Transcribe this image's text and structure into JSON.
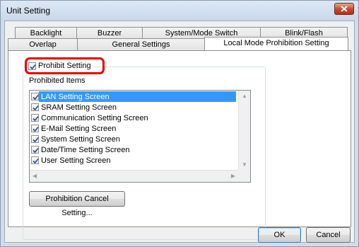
{
  "window": {
    "title": "Unit Setting"
  },
  "tabs": {
    "row_back": [
      "Backlight",
      "Buzzer",
      "System/Mode Switch",
      "Blink/Flash"
    ],
    "row_front": [
      "Overlap",
      "General Settings",
      "Local Mode Prohibition Setting"
    ],
    "active": "Local Mode Prohibition Setting"
  },
  "prohibit": {
    "label": "Prohibit Setting",
    "checked": true
  },
  "items": {
    "label": "Prohibited Items",
    "list": [
      {
        "label": "LAN Setting Screen",
        "checked": true,
        "selected": true
      },
      {
        "label": "SRAM Setting Screen",
        "checked": true,
        "selected": false
      },
      {
        "label": "Communication Setting Screen",
        "checked": true,
        "selected": false
      },
      {
        "label": "E-Mail Setting Screen",
        "checked": true,
        "selected": false
      },
      {
        "label": "System Setting Screen",
        "checked": true,
        "selected": false
      },
      {
        "label": "Date/Time Setting Screen",
        "checked": true,
        "selected": false
      },
      {
        "label": "User Setting Screen",
        "checked": true,
        "selected": false
      }
    ]
  },
  "buttons": {
    "cancel_setting": "Prohibition Cancel Setting...",
    "ok": "OK",
    "cancel": "Cancel"
  },
  "colors": {
    "highlight_ring": "#e60000",
    "selection": "#3399ff"
  }
}
